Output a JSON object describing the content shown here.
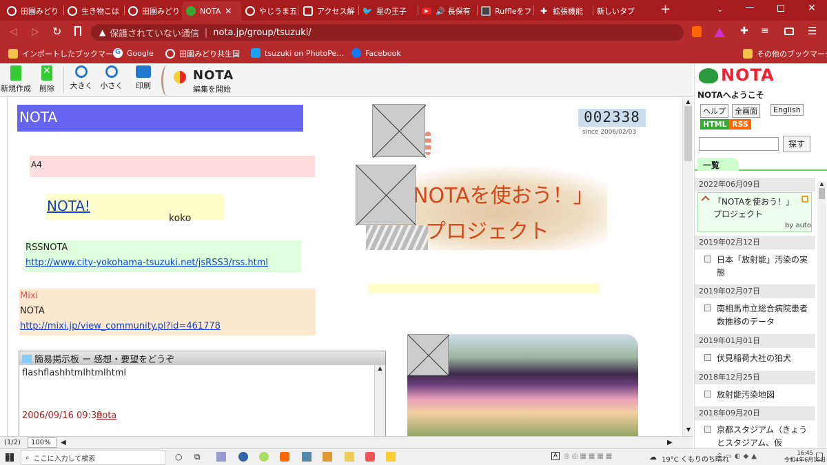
{
  "browser": {
    "tabs": [
      {
        "label": "田園みどり"
      },
      {
        "label": "生き物こは"
      },
      {
        "label": "田園みどり"
      },
      {
        "label": "NOTA",
        "active": true
      },
      {
        "label": "やじうま五"
      },
      {
        "label": "アクセス解"
      },
      {
        "label": "星の王子"
      },
      {
        "label": "長保有"
      },
      {
        "label": "Ruffleをフ"
      },
      {
        "label": "拡張機能"
      },
      {
        "label": "新しいタブ"
      }
    ],
    "new_tab": "+",
    "security_label": "保護されていない通信",
    "url": "nota.jp/group/tsuzuki/",
    "bookmarks": [
      "インポートしたブックマーク",
      "Google",
      "田園みどり共生国",
      "tsuzuki on PhotoPe...",
      "Facebook"
    ],
    "other_bookmarks": "その他のブックマーク"
  },
  "nota_toolbar": {
    "new": "新規作成",
    "delete": "削除",
    "zoom_in": "大きく",
    "zoom_out": "小さく",
    "print": "印刷",
    "logo": "NOTA",
    "edit_start": "編集を開始"
  },
  "canvas": {
    "title": "NOTA",
    "a4": "A4",
    "nota_link": "NOTA!",
    "koko": "koko",
    "rss_title": "RSSNOTA",
    "rss_url": "http://www.city-yokohama-tsuzuki.net/jsRSS3/rss.html",
    "mixi_title": "Mixi",
    "mixi_name": "NOTA",
    "mixi_url": "http://mixi.jp/view_community.pl?id=461778",
    "board_title": "簡易掲示板 ー 感想・要望をどうぞ",
    "board_body": "flashflashhtmlhtmlhtml",
    "board_date": "2006/09/16 09:39",
    "board_user": "nota",
    "counter": "002338",
    "since": "since 2006/02/03",
    "poster_line1": "NOTAを使おう！」",
    "poster_line2": "プロジェクト"
  },
  "status": {
    "page": "(1/2)",
    "zoom": "100%"
  },
  "sidebar": {
    "logo": "NOTA",
    "welcome": "NOTAへようこそ",
    "help": "ヘルプ",
    "fullscreen": "全画面",
    "english": "English",
    "html": "HTML",
    "rss": "RSS",
    "search_button": "探す",
    "list_tab": "一覧",
    "items": [
      {
        "date": "2022年06月09日",
        "title": "「NOTAを使おう！」プロジェクト",
        "by": "by auto"
      },
      {
        "date": "2019年02月12日",
        "title": "日本「放射能」汚染の実態"
      },
      {
        "date": "2019年02月07日",
        "title": "南相馬市立総合病院患者数推移のデータ"
      },
      {
        "date": "2019年01月01日",
        "title": "伏見稲荷大社の狛犬"
      },
      {
        "date": "2018年12月25日",
        "title": "放射能汚染地図"
      },
      {
        "date": "2018年09月20日",
        "title": "京都スタジアム（きょうとスタジアム、仮"
      }
    ]
  },
  "taskbar": {
    "search_placeholder": "ここに入力して検索",
    "weather": "19°C くもりのち晴れ",
    "time": "16:45",
    "date": "令和4年6月15日"
  }
}
